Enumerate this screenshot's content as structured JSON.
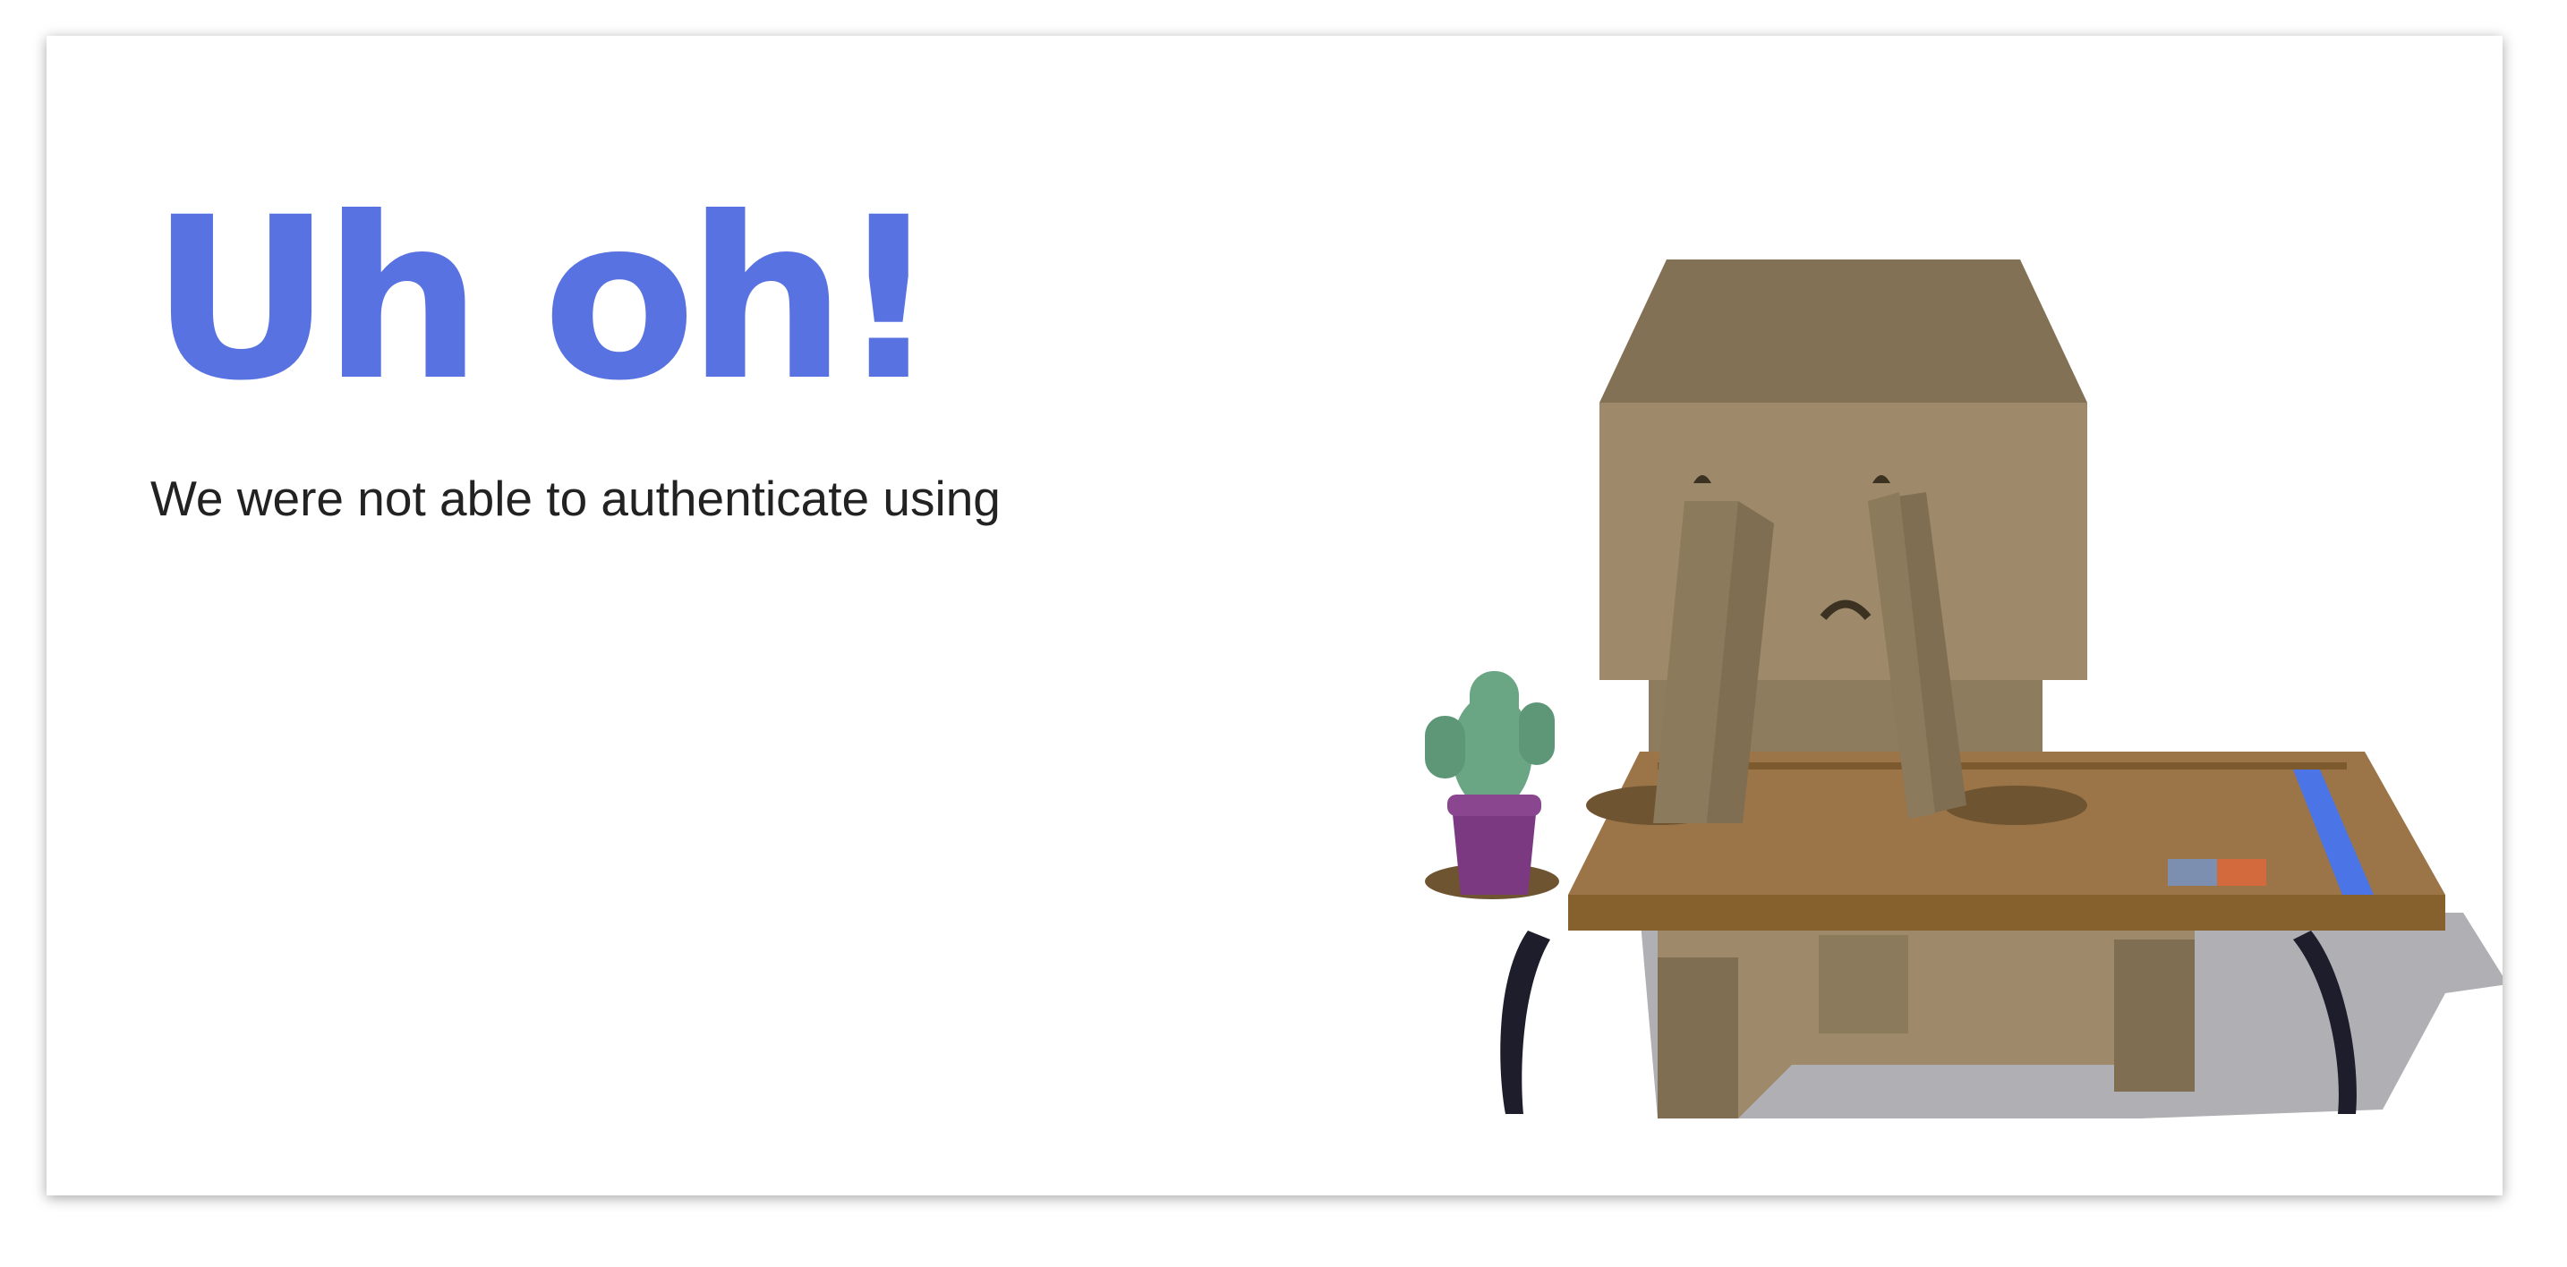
{
  "error_page": {
    "heading": "Uh oh!",
    "message": "We were not able to authenticate using"
  },
  "colors": {
    "heading": "#5872e1",
    "message_text": "#222222",
    "box": "#9e8a6a",
    "box_dark": "#7f6e51",
    "table_top": "#9b7548",
    "table_edge": "#86612e",
    "table_legs": "#1d1d2b",
    "cactus": "#6aa683",
    "pot": "#7a3980",
    "ruler": "#4b74e6",
    "shadow": "#b0b0b4"
  },
  "illustration": {
    "icon": "sad-box-robot-at-desk-illustration"
  }
}
